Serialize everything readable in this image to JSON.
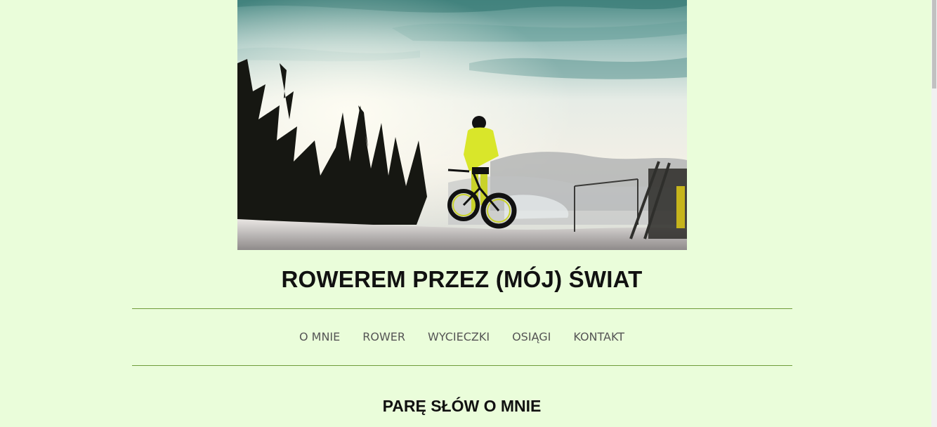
{
  "header": {
    "site_title": "ROWEREM PRZEZ (MÓJ) ŚWIAT"
  },
  "hero": {
    "image_name": "fatbike-rider-winter-mountain-photo"
  },
  "nav": {
    "items": [
      {
        "label": "O MNIE"
      },
      {
        "label": "ROWER"
      },
      {
        "label": "WYCIECZKI"
      },
      {
        "label": "OSIĄGI"
      },
      {
        "label": "KONTAKT"
      }
    ]
  },
  "main": {
    "section_title": "PARĘ SŁÓW O MNIE"
  },
  "colors": {
    "background": "#eafdda",
    "rule": "#6f9c3a",
    "nav_text": "#555555",
    "jacket_accent": "#d9e62a"
  }
}
